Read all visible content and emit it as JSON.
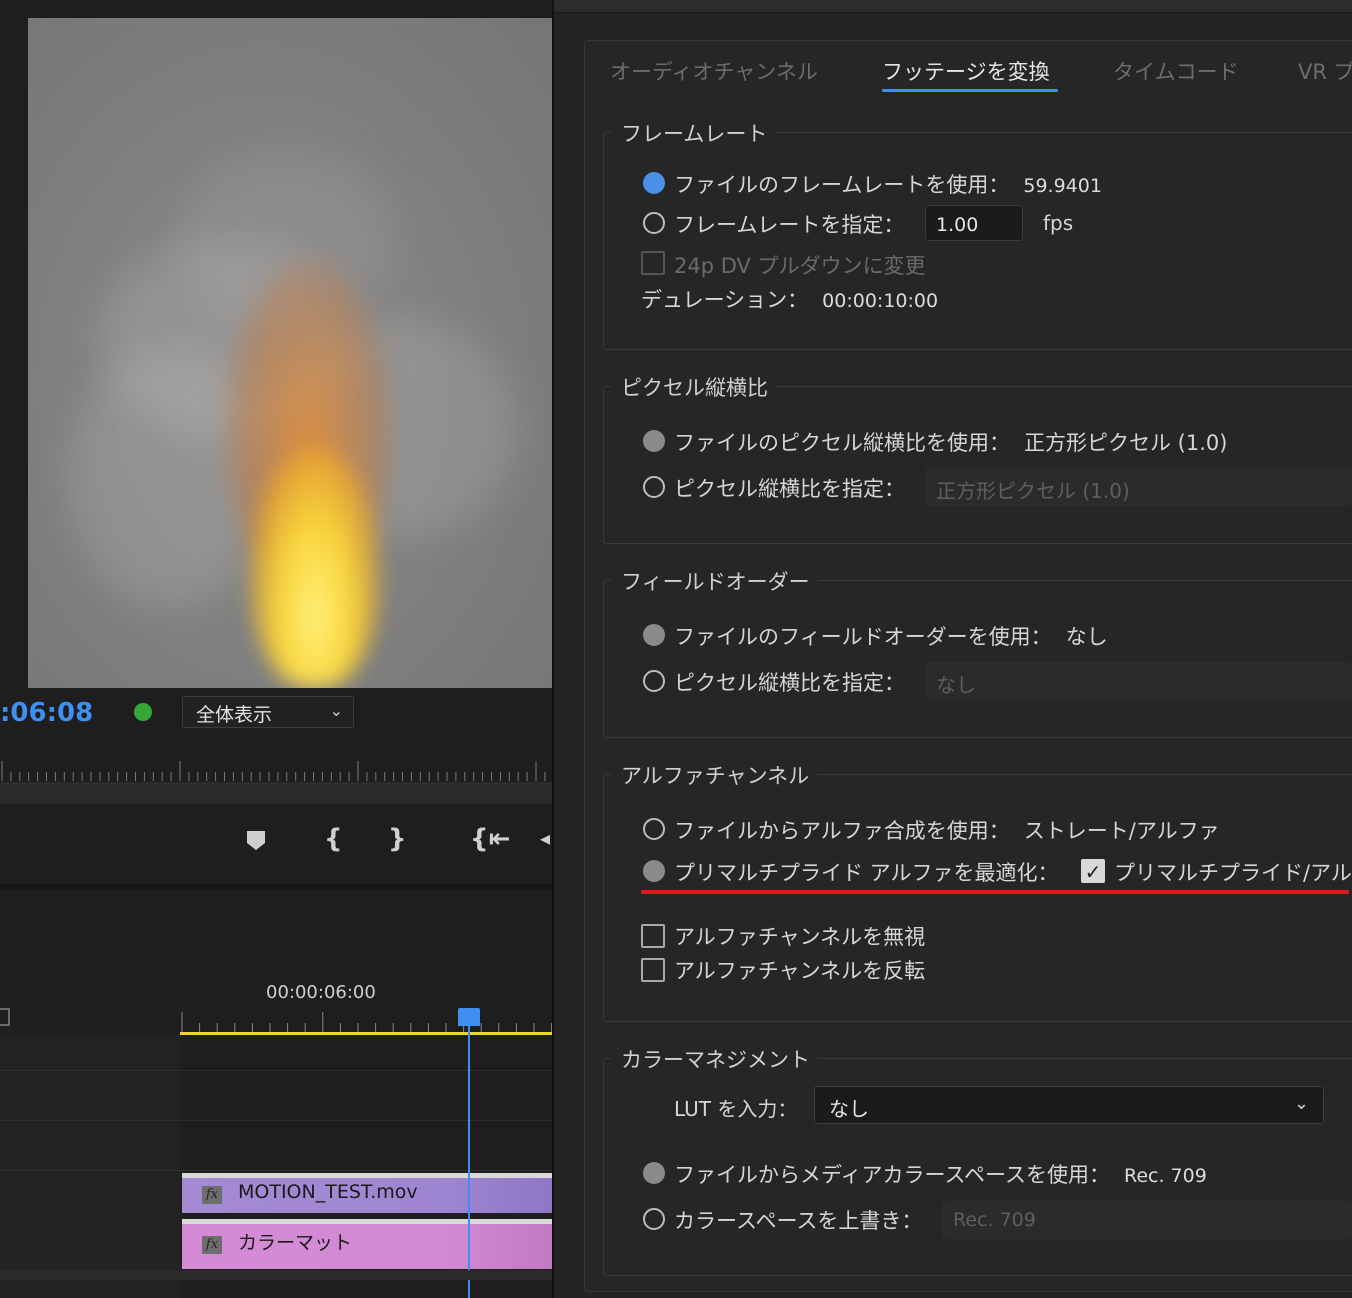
{
  "monitor": {
    "timecode": ":06:08",
    "zoom_label": "全体表示",
    "timeline_time": "00:00:06:00",
    "clips": [
      {
        "fx": "fx",
        "label": "MOTION_TEST.mov",
        "color": "#a48ad4"
      },
      {
        "fx": "fx",
        "label": "カラーマット",
        "color": "#d58ad6"
      }
    ],
    "playhead_color": "#3f8ff0",
    "status_dot_color": "#36a83b"
  },
  "tabs": [
    {
      "label": "オーディオチャンネル",
      "active": false
    },
    {
      "label": "フッテージを変換",
      "active": true
    },
    {
      "label": "タイムコード",
      "active": false
    },
    {
      "label": "VR プ",
      "active": false
    }
  ],
  "frame_rate": {
    "title": "フレームレート",
    "use_file": {
      "label": "ファイルのフレームレートを使用：",
      "value": "59.9401"
    },
    "specify": {
      "label": "フレームレートを指定：",
      "value": "1.00",
      "unit": "fps"
    },
    "pulldown": {
      "label": "24p DV プルダウンに変更"
    },
    "duration": {
      "label": "デュレーション：",
      "value": "00:00:10:00"
    }
  },
  "pixel_aspect": {
    "title": "ピクセル縦横比",
    "use_file": {
      "label": "ファイルのピクセル縦横比を使用：",
      "value": "正方形ピクセル (1.0)"
    },
    "specify": {
      "label": "ピクセル縦横比を指定：",
      "value": "正方形ピクセル (1.0)"
    }
  },
  "field_order": {
    "title": "フィールドオーダー",
    "use_file": {
      "label": "ファイルのフィールドオーダーを使用：",
      "value": "なし"
    },
    "specify": {
      "label": "ピクセル縦横比を指定：",
      "value": "なし"
    }
  },
  "alpha": {
    "title": "アルファチャンネル",
    "use_file": {
      "label": "ファイルからアルファ合成を使用：",
      "value": "ストレート/アルファ"
    },
    "premultiply": {
      "label": "プリマルチプライド アルファを最適化：",
      "value": "プリマルチプライド/アル",
      "checked": true
    },
    "ignore": {
      "label": "アルファチャンネルを無視"
    },
    "invert": {
      "label": "アルファチャンネルを反転"
    },
    "highlight_color": "#e11b1b"
  },
  "color": {
    "title": "カラーマネジメント",
    "lut": {
      "label": "LUT を入力：",
      "value": "なし"
    },
    "use_file": {
      "label": "ファイルからメディアカラースペースを使用：",
      "value": "Rec. 709"
    },
    "override": {
      "label": "カラースペースを上書き：",
      "value": "Rec. 709"
    }
  },
  "icons": {
    "chevron": "⌄",
    "check": "✓",
    "marker": "⬟",
    "in": "{",
    "out": "}",
    "goto_in": "{⇤"
  }
}
